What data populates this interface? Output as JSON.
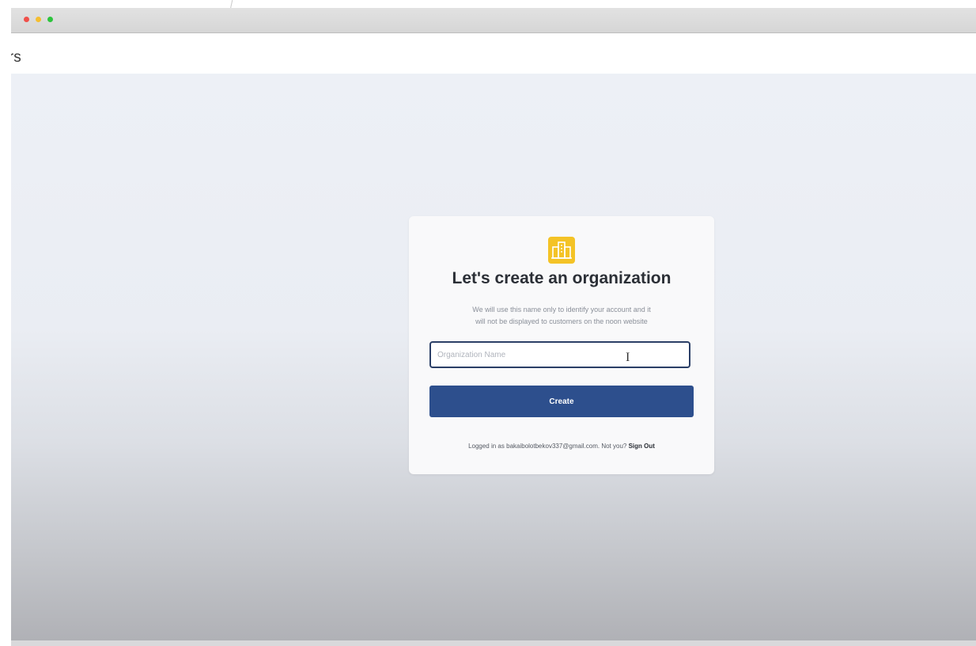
{
  "header": {
    "partial_title": "ers"
  },
  "dialog": {
    "title": "Let's create an organization",
    "subtitle_line1": "We will use this name only to identify your account and it",
    "subtitle_line2": "will not be displayed to customers on the noon website",
    "input_placeholder": "Organization Name",
    "input_value": "",
    "create_label": "Create",
    "logged_in_prefix": "Logged in as",
    "email": "bakaibolotbekov337@gmail.com.",
    "not_you": "Not you?",
    "sign_out_label": "Sign Out",
    "icon": "organization-building-icon"
  },
  "colors": {
    "accent": "#2d4f8d",
    "icon_bg": "#f4c326",
    "input_border": "#2b3f67"
  }
}
